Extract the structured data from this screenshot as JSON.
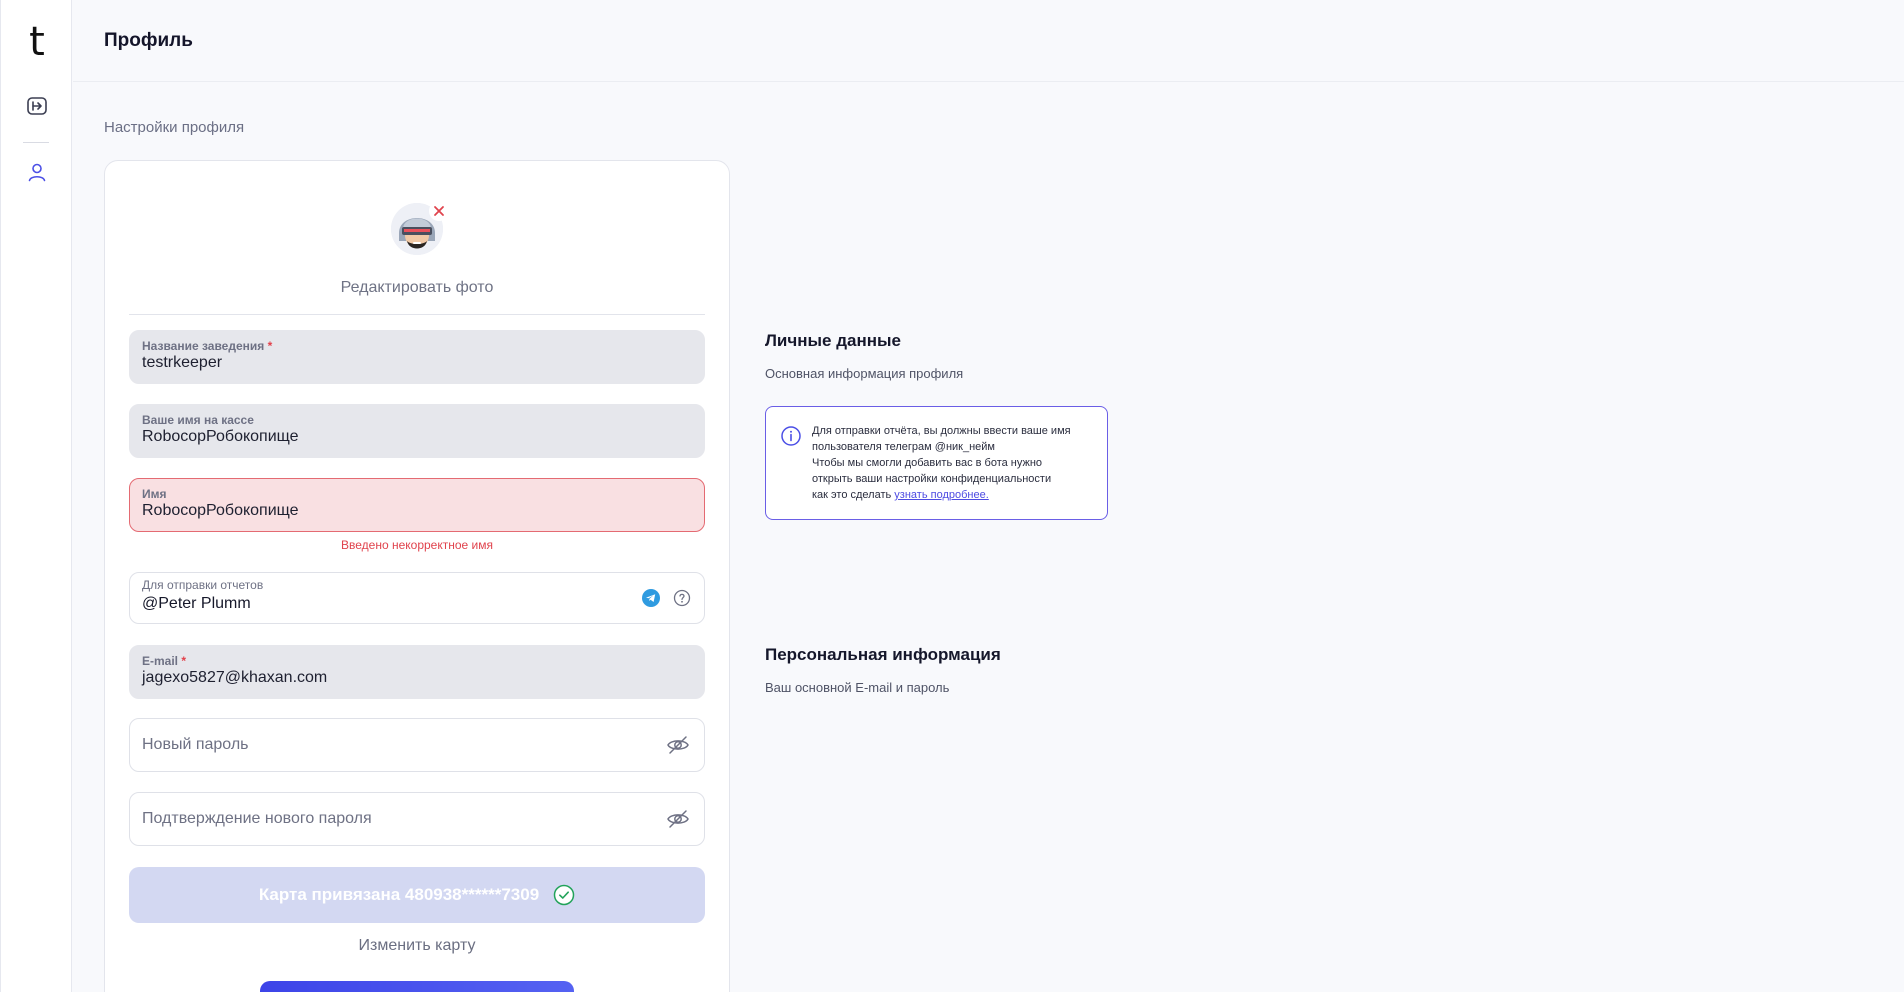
{
  "app": {
    "logo": "t"
  },
  "header": {
    "title": "Профиль"
  },
  "section_caption": "Настройки профиля",
  "profile": {
    "edit_photo": "Редактировать фото",
    "fields": {
      "venue": {
        "label": "Название заведения",
        "required_mark": "*",
        "value": "testrkeeper"
      },
      "cashier_name": {
        "label": "Ваше имя на кассе",
        "value": "RobocopРобокопище"
      },
      "name": {
        "label": "Имя",
        "value": "RobocopРобокопище",
        "error": "Введено некорректное имя"
      },
      "telegram": {
        "label": "Для отправки отчетов",
        "value": "@Peter Plumm"
      },
      "email": {
        "label": "E-mail",
        "required_mark": "*",
        "value": "jagexo5827@khaxan.com"
      },
      "new_password": {
        "placeholder": "Новый пароль"
      },
      "confirm_password": {
        "placeholder": "Подтверждение нового пароля"
      }
    },
    "card_bound": "Карта привязана 480938******7309",
    "change_card": "Изменить карту"
  },
  "personal": {
    "title": "Личные данные",
    "subtitle": "Основная информация профиля",
    "notice": {
      "line1": "Для отправки отчёта, вы должны ввести ваше имя",
      "line2": "пользователя телеграм @ник_нейм",
      "line3": "Чтобы мы смогли добавить вас в бота нужно",
      "line4": "открыть ваши настройки конфиденциальности",
      "line5_prefix": "как это сделать ",
      "link": "узнать подробнее."
    }
  },
  "personal_info": {
    "title": "Персональная информация",
    "subtitle": "Ваш основной E-mail и пароль"
  },
  "colors": {
    "accent": "#4b4fe6",
    "error": "#e0434d",
    "success": "#22a35a",
    "telegram": "#2f9be0",
    "card_bound_bg": "#d3d8f2"
  }
}
